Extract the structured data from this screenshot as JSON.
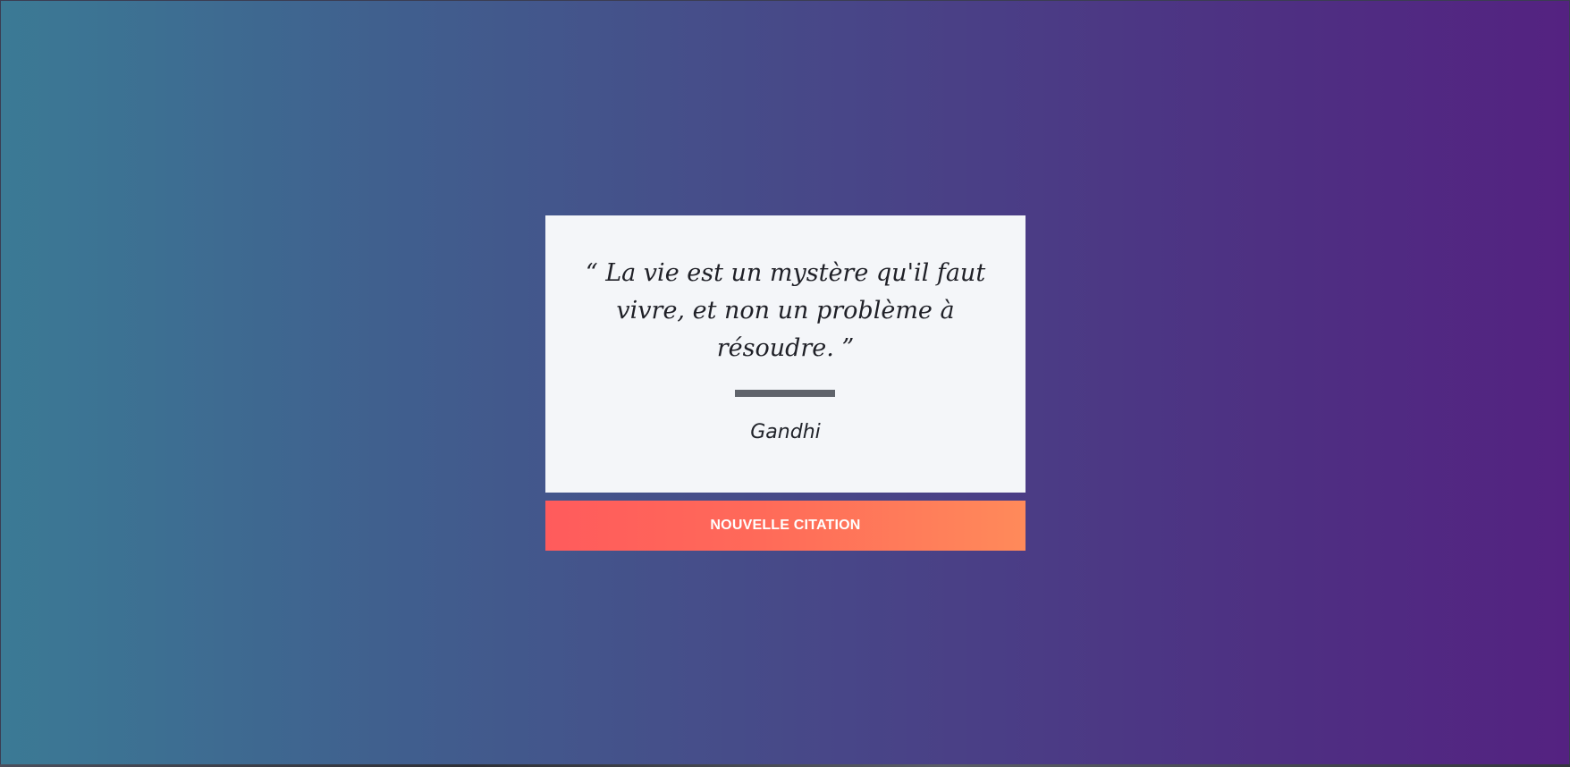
{
  "quote": {
    "text": "“ La vie est un mystère qu'il faut vivre, et non un problème à résoudre. ”",
    "author": "Gandhi"
  },
  "actions": {
    "new_quote_label": "NOUVELLE CITATION"
  },
  "colors": {
    "gradient_start": "#3b7a95",
    "gradient_end": "#542281",
    "card_background": "#f4f6f9",
    "divider": "#5f636b",
    "button_gradient_start": "#ff5b5c",
    "button_gradient_end": "#ff8a5a"
  }
}
